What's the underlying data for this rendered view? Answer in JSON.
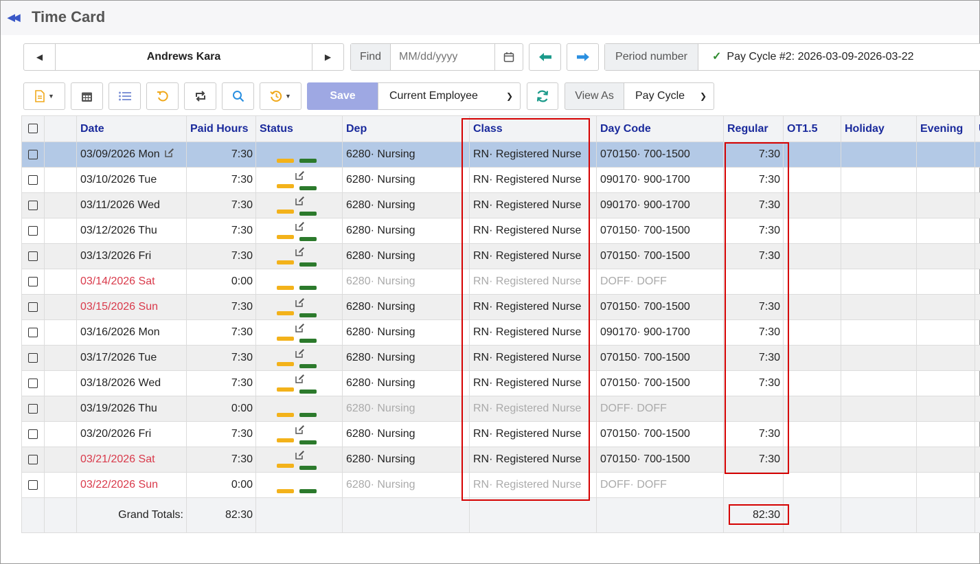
{
  "header": {
    "title": "Time Card"
  },
  "employee_nav": {
    "name": "Andrews Kara"
  },
  "find": {
    "label": "Find",
    "placeholder": "MM/dd/yyyy"
  },
  "period": {
    "label": "Period number",
    "value": "Pay Cycle #2: 2026-03-09-2026-03-22"
  },
  "toolbar": {
    "save_label": "Save",
    "scope_select": "Current Employee",
    "view_as_label": "View As",
    "view_as_select": "Pay Cycle"
  },
  "columns": [
    "Date",
    "Paid Hours",
    "Status",
    "Dep",
    "Class",
    "Day Code",
    "Regular",
    "OT1.5",
    "Holiday",
    "Evening"
  ],
  "rows": [
    {
      "date": "03/09/2026 Mon",
      "paid": "7:30",
      "dep": "6280· Nursing",
      "cls": "RN· Registered Nurse",
      "code": "070150· 700-1500",
      "regular": "7:30"
    },
    {
      "date": "03/10/2026 Tue",
      "paid": "7:30",
      "dep": "6280· Nursing",
      "cls": "RN· Registered Nurse",
      "code": "090170· 900-1700",
      "regular": "7:30"
    },
    {
      "date": "03/11/2026 Wed",
      "paid": "7:30",
      "dep": "6280· Nursing",
      "cls": "RN· Registered Nurse",
      "code": "090170· 900-1700",
      "regular": "7:30"
    },
    {
      "date": "03/12/2026 Thu",
      "paid": "7:30",
      "dep": "6280· Nursing",
      "cls": "RN· Registered Nurse",
      "code": "070150· 700-1500",
      "regular": "7:30"
    },
    {
      "date": "03/13/2026 Fri",
      "paid": "7:30",
      "dep": "6280· Nursing",
      "cls": "RN· Registered Nurse",
      "code": "070150· 700-1500",
      "regular": "7:30"
    },
    {
      "date": "03/14/2026 Sat",
      "paid": "0:00",
      "dep": "6280· Nursing",
      "cls": "RN· Registered Nurse",
      "code": "DOFF· DOFF",
      "regular": ""
    },
    {
      "date": "03/15/2026 Sun",
      "paid": "7:30",
      "dep": "6280· Nursing",
      "cls": "RN· Registered Nurse",
      "code": "070150· 700-1500",
      "regular": "7:30"
    },
    {
      "date": "03/16/2026 Mon",
      "paid": "7:30",
      "dep": "6280· Nursing",
      "cls": "RN· Registered Nurse",
      "code": "090170· 900-1700",
      "regular": "7:30"
    },
    {
      "date": "03/17/2026 Tue",
      "paid": "7:30",
      "dep": "6280· Nursing",
      "cls": "RN· Registered Nurse",
      "code": "070150· 700-1500",
      "regular": "7:30"
    },
    {
      "date": "03/18/2026 Wed",
      "paid": "7:30",
      "dep": "6280· Nursing",
      "cls": "RN· Registered Nurse",
      "code": "070150· 700-1500",
      "regular": "7:30"
    },
    {
      "date": "03/19/2026 Thu",
      "paid": "0:00",
      "dep": "6280· Nursing",
      "cls": "RN· Registered Nurse",
      "code": "DOFF· DOFF",
      "regular": ""
    },
    {
      "date": "03/20/2026 Fri",
      "paid": "7:30",
      "dep": "6280· Nursing",
      "cls": "RN· Registered Nurse",
      "code": "070150· 700-1500",
      "regular": "7:30"
    },
    {
      "date": "03/21/2026 Sat",
      "paid": "7:30",
      "dep": "6280· Nursing",
      "cls": "RN· Registered Nurse",
      "code": "070150· 700-1500",
      "regular": "7:30"
    },
    {
      "date": "03/22/2026 Sun",
      "paid": "0:00",
      "dep": "6280· Nursing",
      "cls": "RN· Registered Nurse",
      "code": "DOFF· DOFF",
      "regular": ""
    }
  ],
  "totals": {
    "label": "Grand Totals:",
    "paid": "82:30",
    "regular": "82:30"
  },
  "colors": {
    "accent": "#1a2a9c",
    "weekend": "#d9394a",
    "selected_row": "#b3c9e6",
    "highlight": "#d50000",
    "status_yellow": "#f3b21a",
    "status_green": "#2c7a2c",
    "save": "#9ea8e3"
  }
}
